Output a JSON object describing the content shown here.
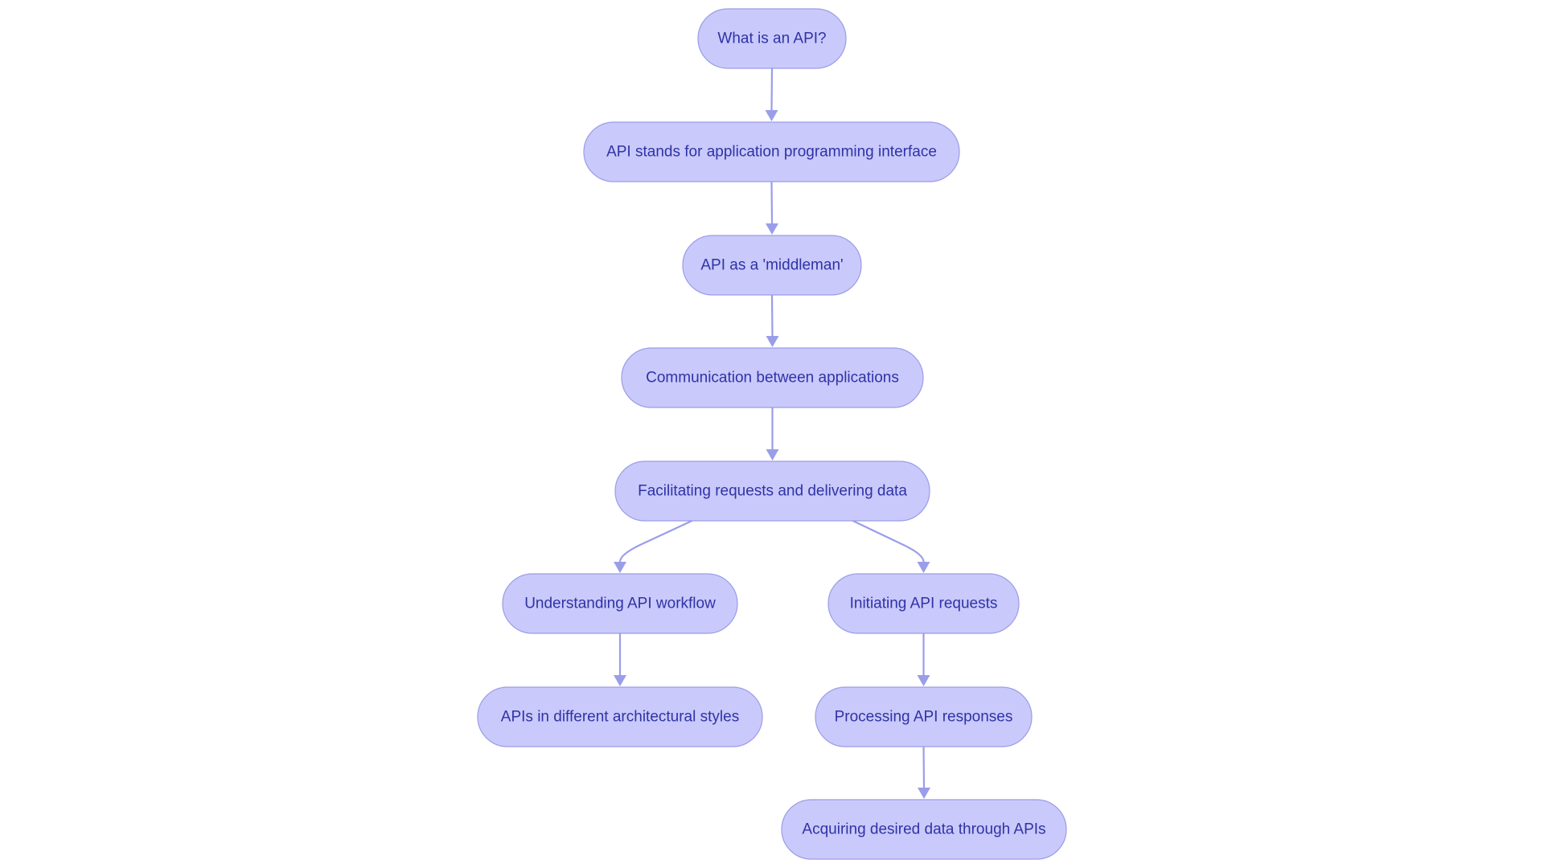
{
  "diagram": {
    "type": "flowchart",
    "direction": "top-down",
    "colors": {
      "node_fill": "#c9c9fb",
      "node_border": "#9b9de6",
      "node_text": "#2f33a6",
      "edge": "#9a9ee8",
      "background": "#ffffff"
    },
    "nodes": [
      {
        "id": "n1",
        "label": "What is an API?"
      },
      {
        "id": "n2",
        "label": "API stands for application programming interface"
      },
      {
        "id": "n3",
        "label": "API as a 'middleman'"
      },
      {
        "id": "n4",
        "label": "Communication between applications"
      },
      {
        "id": "n5",
        "label": "Facilitating requests and delivering data"
      },
      {
        "id": "n6",
        "label": "Understanding API workflow"
      },
      {
        "id": "n7",
        "label": "Initiating API requests"
      },
      {
        "id": "n8",
        "label": "APIs in different architectural styles"
      },
      {
        "id": "n9",
        "label": "Processing API responses"
      },
      {
        "id": "n10",
        "label": "Acquiring desired data through APIs"
      }
    ],
    "edges": [
      {
        "from": "n1",
        "to": "n2"
      },
      {
        "from": "n2",
        "to": "n3"
      },
      {
        "from": "n3",
        "to": "n4"
      },
      {
        "from": "n4",
        "to": "n5"
      },
      {
        "from": "n5",
        "to": "n6"
      },
      {
        "from": "n5",
        "to": "n7"
      },
      {
        "from": "n6",
        "to": "n8"
      },
      {
        "from": "n7",
        "to": "n9"
      },
      {
        "from": "n9",
        "to": "n10"
      }
    ]
  }
}
